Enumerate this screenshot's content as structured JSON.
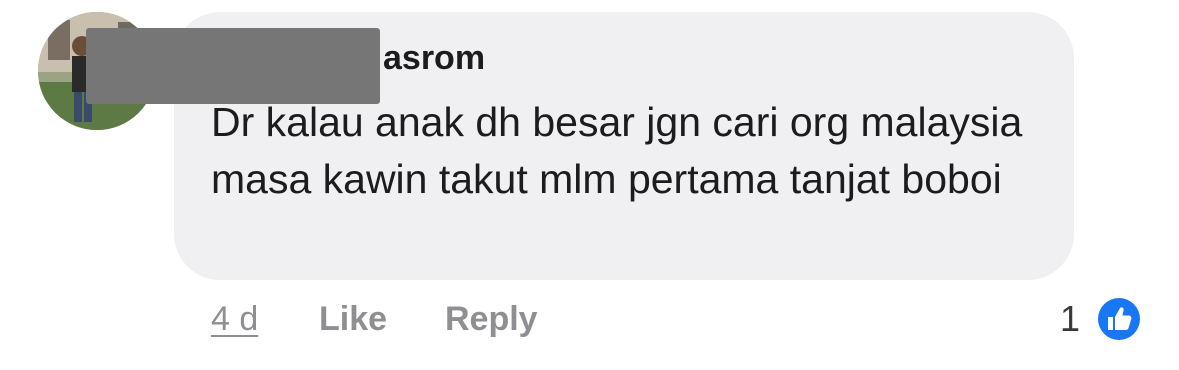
{
  "comment": {
    "author_name_visible": "asrom",
    "text": "Dr kalau anak dh besar jgn cari org malaysia masa kawin takut mlm pertama tanjat boboi",
    "timestamp": "4 d"
  },
  "actions": {
    "like_label": "Like",
    "reply_label": "Reply"
  },
  "reactions": {
    "count": "1",
    "icon": "thumbs-up-icon",
    "color": "#1877f2"
  },
  "colors": {
    "bubble": "#f0f0f3",
    "meta_text": "#8e8e93",
    "redaction": "#767676"
  }
}
